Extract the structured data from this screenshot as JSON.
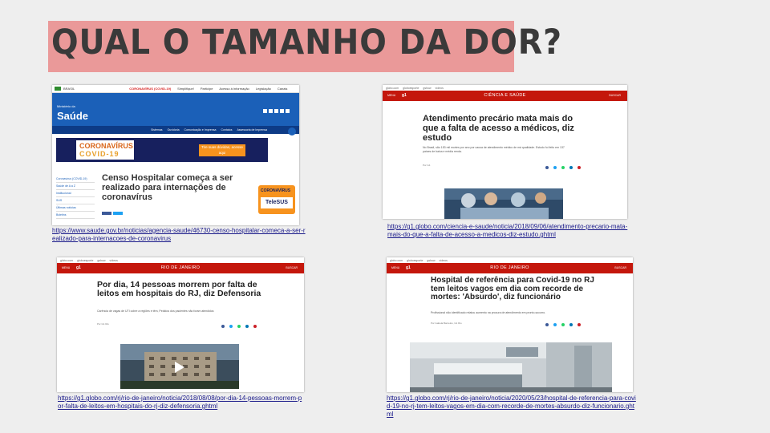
{
  "slide": {
    "title": "QUAL O TAMANHO DA DOR?",
    "colors": {
      "title_bg": "#ea9999",
      "title_text": "#3a3a3a",
      "page_bg": "#eeeeee",
      "globo_red": "#c4170c",
      "saude_blue": "#1b60b8"
    }
  },
  "cards": {
    "saude": {
      "link": "https://www.saude.gov.br/noticias/agencia-saude/46730-censo-hospitalar-comeca-a-ser-realizado-para-internacoes-de-coronavirus",
      "gov_label": "BRASIL",
      "covid_label": "CORONAVÍRUS (COVID-19)",
      "gov_links": [
        "Simplifique!",
        "Participe",
        "Acesso à informação",
        "Legislação",
        "Canais"
      ],
      "ministry": "Ministério da",
      "site_name": "Saúde",
      "nav": [
        "Sistemas",
        "Ouvidoria",
        "Comunicação e Imprensa",
        "Contatos",
        "Assessoria de Imprensa"
      ],
      "banner_title_1": "CORONAVÍRUS",
      "banner_title_2": "COVID-19",
      "banner_cta": "Tire suas dúvidas, acesse aqui",
      "sidebar": [
        "Coronavírus (COVID-19)",
        "Saúde de A a Z",
        "Institucional",
        "SUS",
        "Últimas notícias",
        "Boletins"
      ],
      "headline": "Censo Hospitalar começa a ser realizado para internações de coronavírus",
      "telesus_1": "CORONAVÍRUS",
      "telesus_2": "TeleSUS"
    },
    "globo_ciencia": {
      "link": "https://g1.globo.com/ciencia-e-saude/noticia/2018/09/06/atendimento-precario-mata-mais-do-que-a-falta-de-acesso-a-medicos-diz-estudo.ghtml",
      "top": [
        "globo.com",
        "globoesporte",
        "gshow",
        "vídeos"
      ],
      "menu": "MENU",
      "brand": "g1",
      "section": "CIÊNCIA E SAÚDE",
      "search": "BUSCAR",
      "headline": "Atendimento precário mata mais do que a falta de acesso a médicos, diz estudo",
      "subtitle": "No Brasil, são 153 mil mortes por ano por causa de atendimento médico de má qualidade. Estudo foi feito em 137 países de baixa e média renda.",
      "byline": "Por G1"
    },
    "globo_rio_1": {
      "link": "https://g1.globo.com/rj/rio-de-janeiro/noticia/2018/08/08/por-dia-14-pessoas-morrem-por-falta-de-leitos-em-hospitais-do-rj-diz-defensoria.ghtml",
      "top": [
        "globo.com",
        "globoesporte",
        "gshow",
        "vídeos"
      ],
      "menu": "MENU",
      "brand": "g1",
      "section": "RIO DE JANEIRO",
      "search": "BUSCAR",
      "headline": "Por dia, 14 pessoas morrem por falta de leitos em hospitais do RJ, diz Defensoria",
      "subtitle": "Carência de vagas de UTI cobre a regiões e têm, Pedidos dos pacientes não foram atendidos",
      "byline": "Por G1 Rio"
    },
    "globo_rio_2": {
      "link": "https://g1.globo.com/rj/rio-de-janeiro/noticia/2020/05/23/hospital-de-referencia-para-covid-19-no-rj-tem-leitos-vagos-em-dia-com-recorde-de-mortes-absurdo-diz-funcionario.ghtml",
      "top": [
        "globo.com",
        "globoesporte",
        "gshow",
        "vídeos"
      ],
      "menu": "MENU",
      "brand": "g1",
      "section": "RIO DE JANEIRO",
      "search": "BUSCAR",
      "headline": "Hospital de referência para Covid-19 no RJ tem leitos vagos em dia com recorde de mortes: 'Absurdo', diz funcionário",
      "subtitle": "Profissional não identificado relatou aumento na procura de atendimento em pronto-socorro.",
      "byline": "Por Isabela Barcelos, G1 Rio"
    }
  }
}
